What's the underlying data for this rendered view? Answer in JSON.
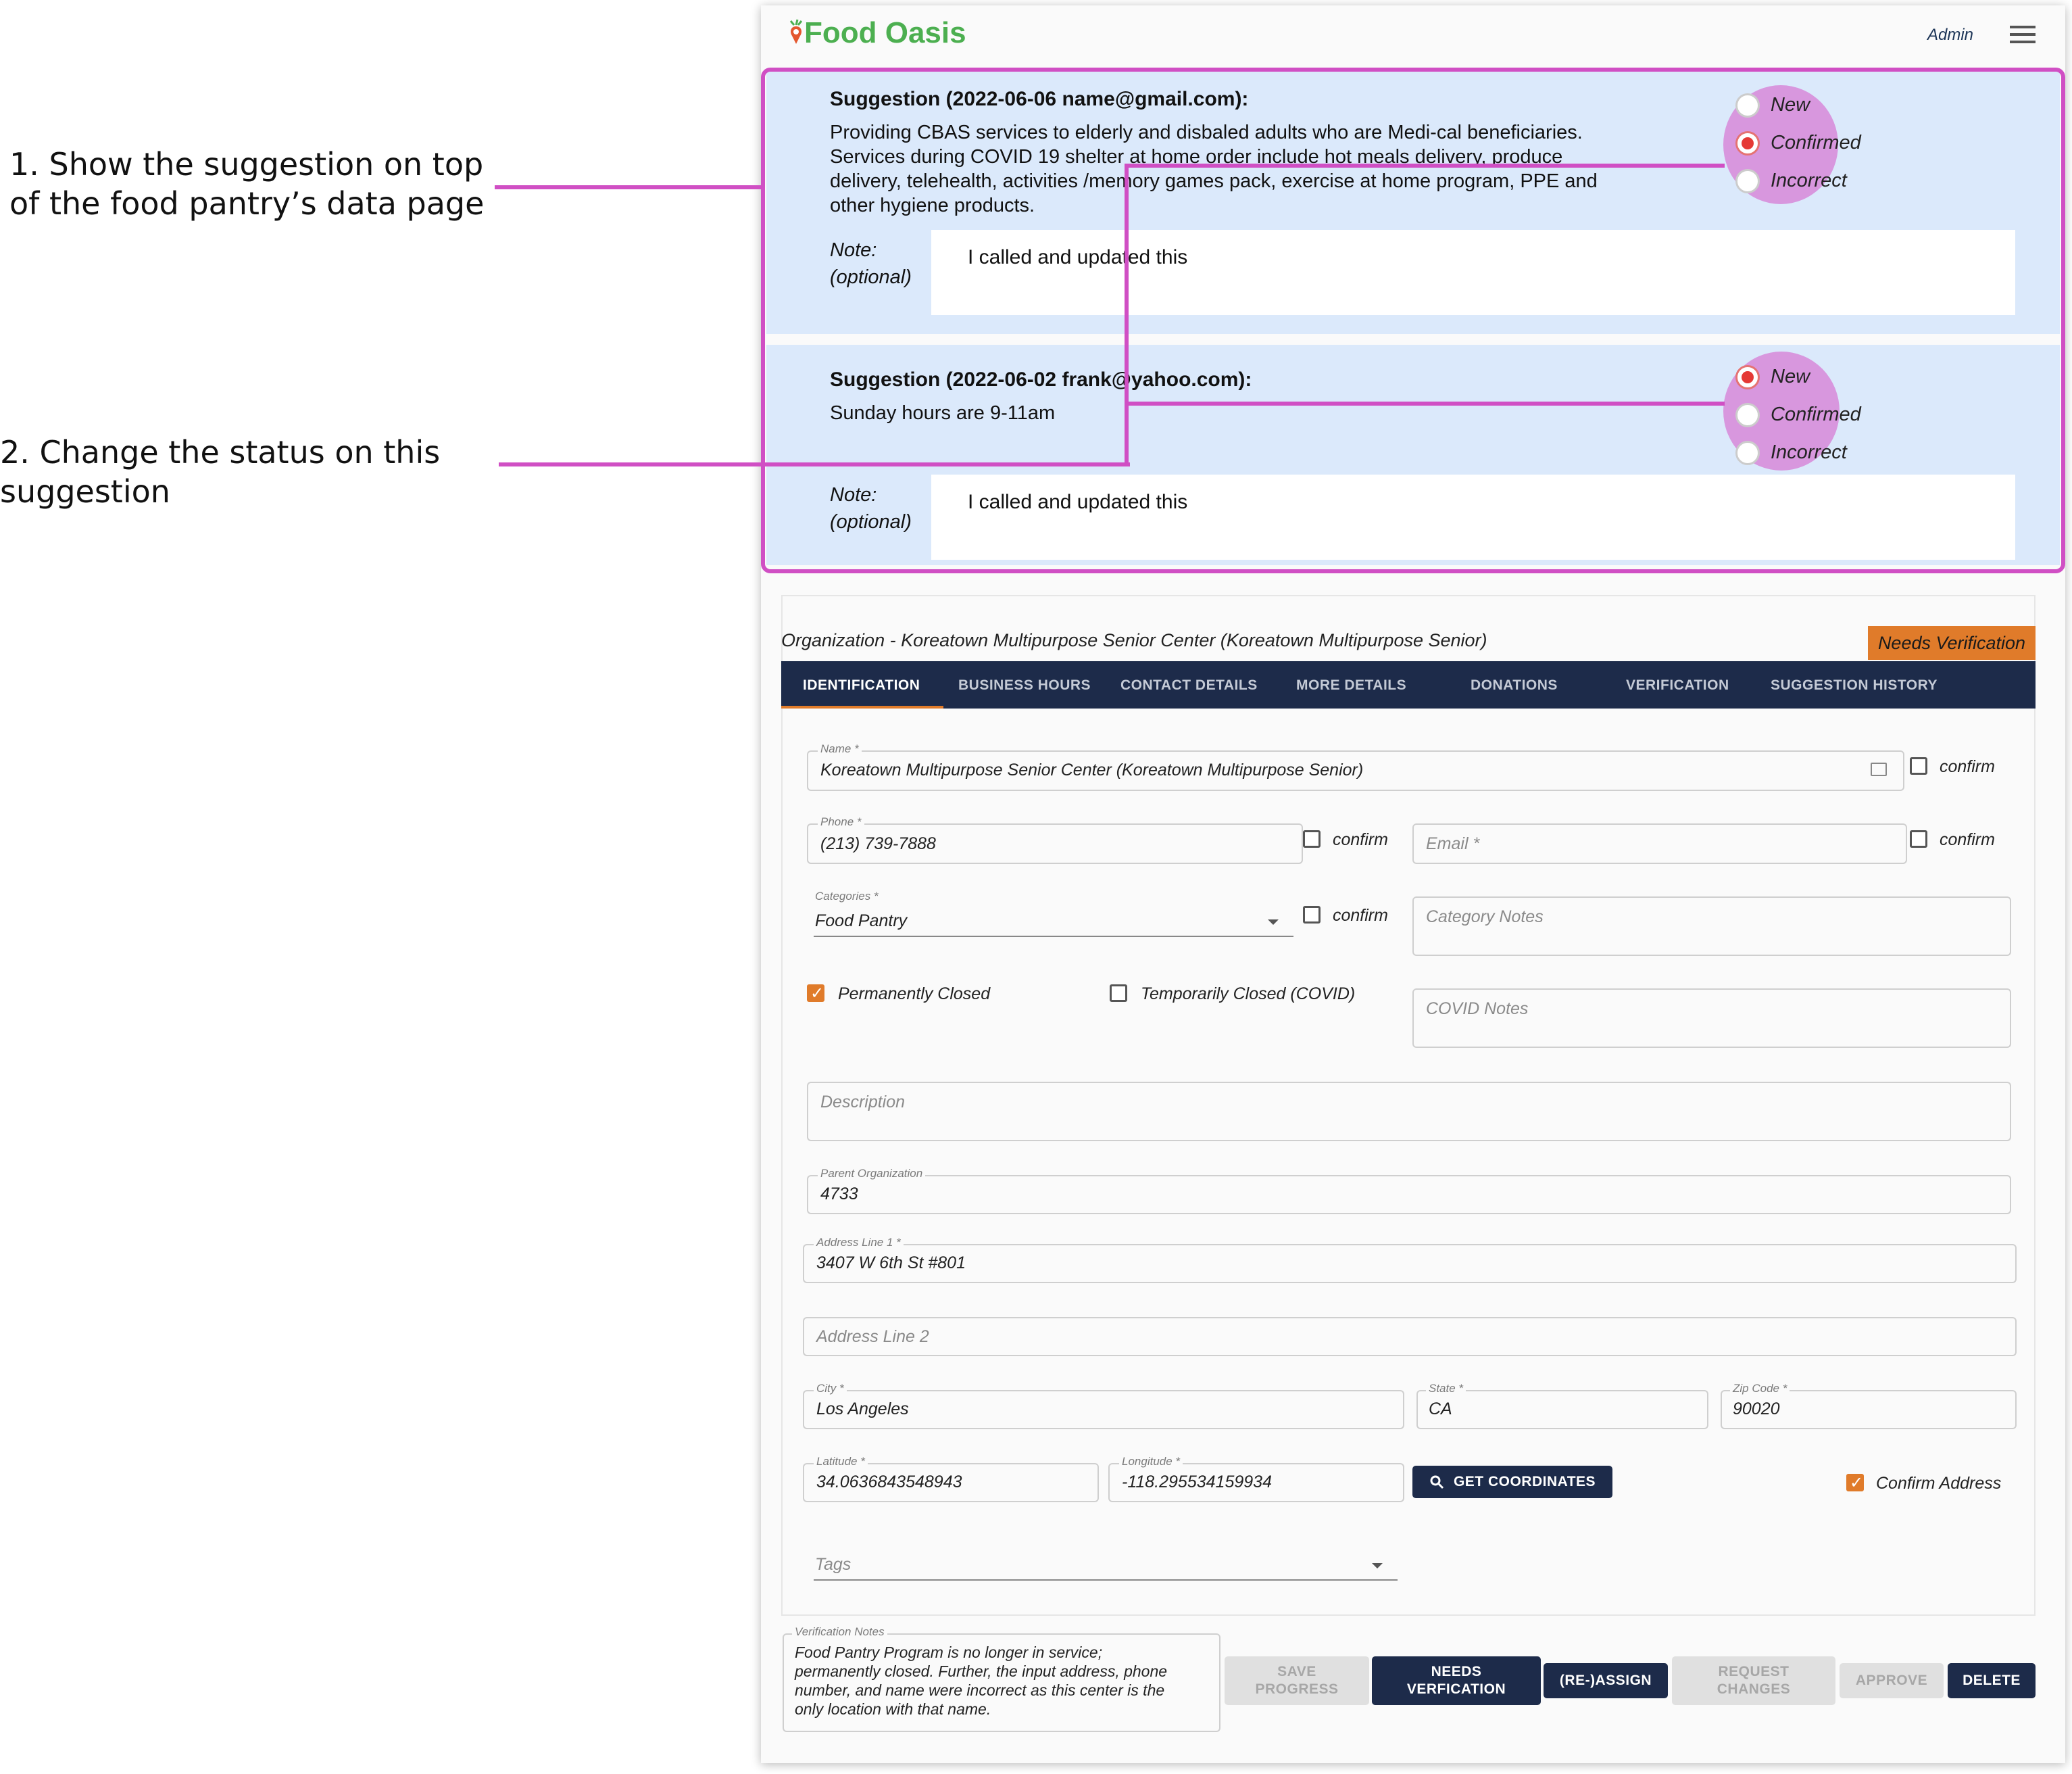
{
  "annotations": {
    "step1_line1": "1. Show the suggestion on top",
    "step1_line2": "of the food pantry’s data page",
    "step2_line1": "2. Change the status on this",
    "step2_line2": "suggestion",
    "highlight_color": "#d04fc4"
  },
  "header": {
    "logo_text": "Food Oasis",
    "logo_icon": "carrot-pin-icon",
    "admin_label": "Admin",
    "menu_icon": "hamburger-menu-icon",
    "brand_color": "#4caf50"
  },
  "suggestions": [
    {
      "title": "Suggestion (2022-06-06 name@gmail.com):",
      "text_lines": [
        "Providing CBAS services to elderly and disbaled adults who are Medi-cal beneficiaries.",
        "Services during COVID 19 shelter at home order include hot meals delivery, produce",
        "delivery, telehealth, activities /memory games pack, exercise at home program, PPE and",
        "other hygiene products."
      ],
      "note_label_1": "Note:",
      "note_label_2": "(optional)",
      "note_value": "I called and updated this",
      "status_options": [
        "New",
        "Confirmed",
        "Incorrect"
      ],
      "selected_status": "Confirmed"
    },
    {
      "title": "Suggestion (2022-06-02 frank@yahoo.com):",
      "text_lines": [
        "Sunday hours are 9-11am"
      ],
      "note_label_1": "Note:",
      "note_label_2": "(optional)",
      "note_value": "I called and updated this",
      "status_options": [
        "New",
        "Confirmed",
        "Incorrect"
      ],
      "selected_status": "New"
    }
  ],
  "organization": {
    "title": "Organization - Koreatown Multipurpose Senior Center (Koreatown Multipurpose Senior)",
    "status_badge": "Needs Verification",
    "badge_color": "#e07b2a"
  },
  "tabs": [
    "IDENTIFICATION",
    "BUSINESS HOURS",
    "CONTACT DETAILS",
    "MORE DETAILS",
    "DONATIONS",
    "VERIFICATION",
    "SUGGESTION HISTORY"
  ],
  "active_tab": "IDENTIFICATION",
  "form": {
    "name_label": "Name *",
    "name_value": "Koreatown Multipurpose Senior Center (Koreatown Multipurpose Senior)",
    "confirm_label": "confirm",
    "phone_label": "Phone *",
    "phone_value": "(213) 739-7888",
    "email_placeholder": "Email *",
    "categories_label": "Categories *",
    "categories_value": "Food Pantry",
    "category_notes_placeholder": "Category Notes",
    "permanently_closed_label": "Permanently Closed",
    "permanently_closed_checked": true,
    "temporarily_closed_label": "Temporarily Closed (COVID)",
    "temporarily_closed_checked": false,
    "covid_notes_placeholder": "COVID Notes",
    "description_placeholder": "Description",
    "parent_org_label": "Parent Organization",
    "parent_org_value": "4733",
    "address1_label": "Address Line 1 *",
    "address1_value": "3407 W 6th St #801",
    "address2_placeholder": "Address Line 2",
    "city_label": "City *",
    "city_value": "Los Angeles",
    "state_label": "State *",
    "state_value": "CA",
    "zip_label": "Zip Code *",
    "zip_value": "90020",
    "latitude_label": "Latitude *",
    "latitude_value": "34.0636843548943",
    "longitude_label": "Longitude *",
    "longitude_value": "-118.295534159934",
    "get_coordinates_label": "GET COORDINATES",
    "confirm_address_label": "Confirm Address",
    "confirm_address_checked": true,
    "tags_placeholder": "Tags"
  },
  "verification": {
    "notes_label": "Verification Notes",
    "notes_lines": [
      "Food Pantry Program is no longer in service;",
      "permanently closed. Further, the input address, phone",
      "number, and name were incorrect as this center is the",
      "only location with that name."
    ]
  },
  "actions": {
    "save_progress_1": "SAVE",
    "save_progress_2": "PROGRESS",
    "needs_verification_1": "NEEDS",
    "needs_verification_2": "VERFICATION",
    "reassign": "(RE-)ASSIGN",
    "request_changes_1": "REQUEST",
    "request_changes_2": "CHANGES",
    "approve": "APPROVE",
    "delete": "DELETE"
  }
}
